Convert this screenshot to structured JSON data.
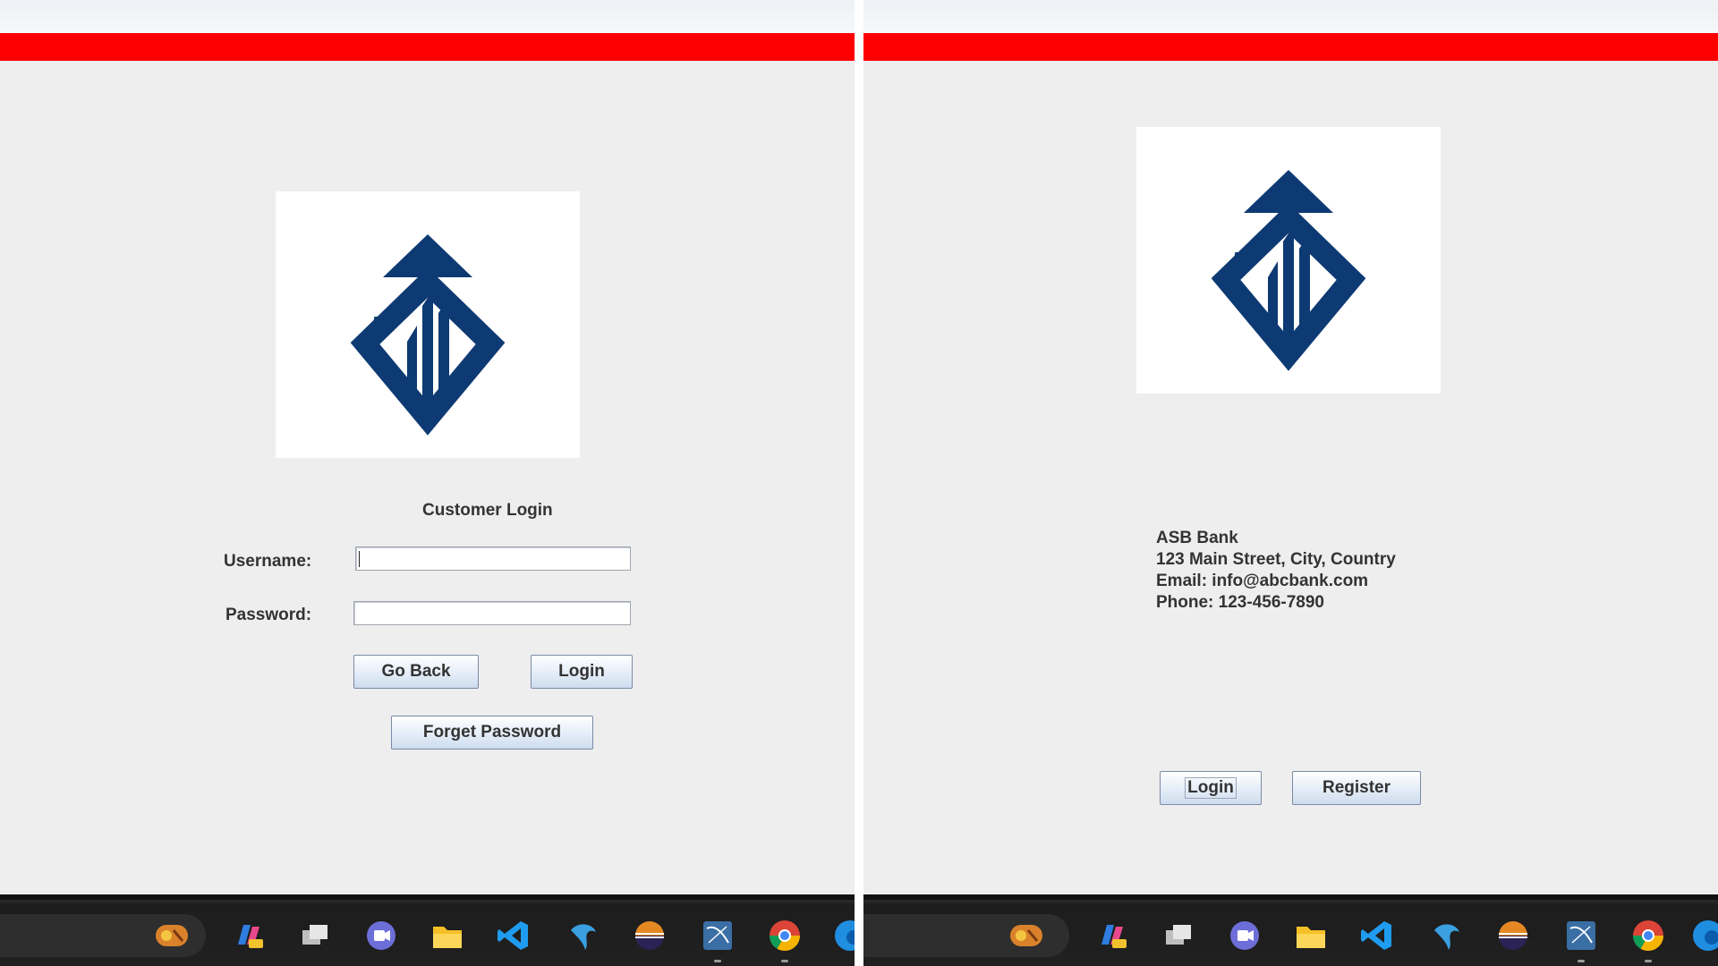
{
  "colors": {
    "red_bar": "#ff0000",
    "logo_navy": "#0e3a73",
    "panel_bg": "#eeeeee",
    "taskbar_bg": "#202020"
  },
  "login_screen": {
    "logo": {
      "icon": "asb-bank-logo-icon"
    },
    "heading": "Customer Login",
    "username_label": "Username:",
    "username_value": "",
    "password_label": "Password:",
    "password_value": "",
    "go_back_label": "Go Back",
    "login_label": "Login",
    "forget_password_label": "Forget Password"
  },
  "welcome_screen": {
    "logo": {
      "icon": "asb-bank-logo-icon"
    },
    "bank_name": "ASB Bank",
    "address": "123 Main Street, City, Country",
    "email": "Email: info@abcbank.com",
    "phone": "Phone: 123-456-7890",
    "login_label": "Login",
    "register_label": "Register"
  },
  "taskbar": {
    "icons": [
      "search-icon",
      "copilot-icon",
      "task-view-icon",
      "teams-icon",
      "file-explorer-icon",
      "vscode-icon",
      "mysql-icon",
      "eclipse-icon",
      "mysql-workbench-icon",
      "chrome-icon",
      "edge-icon"
    ]
  }
}
